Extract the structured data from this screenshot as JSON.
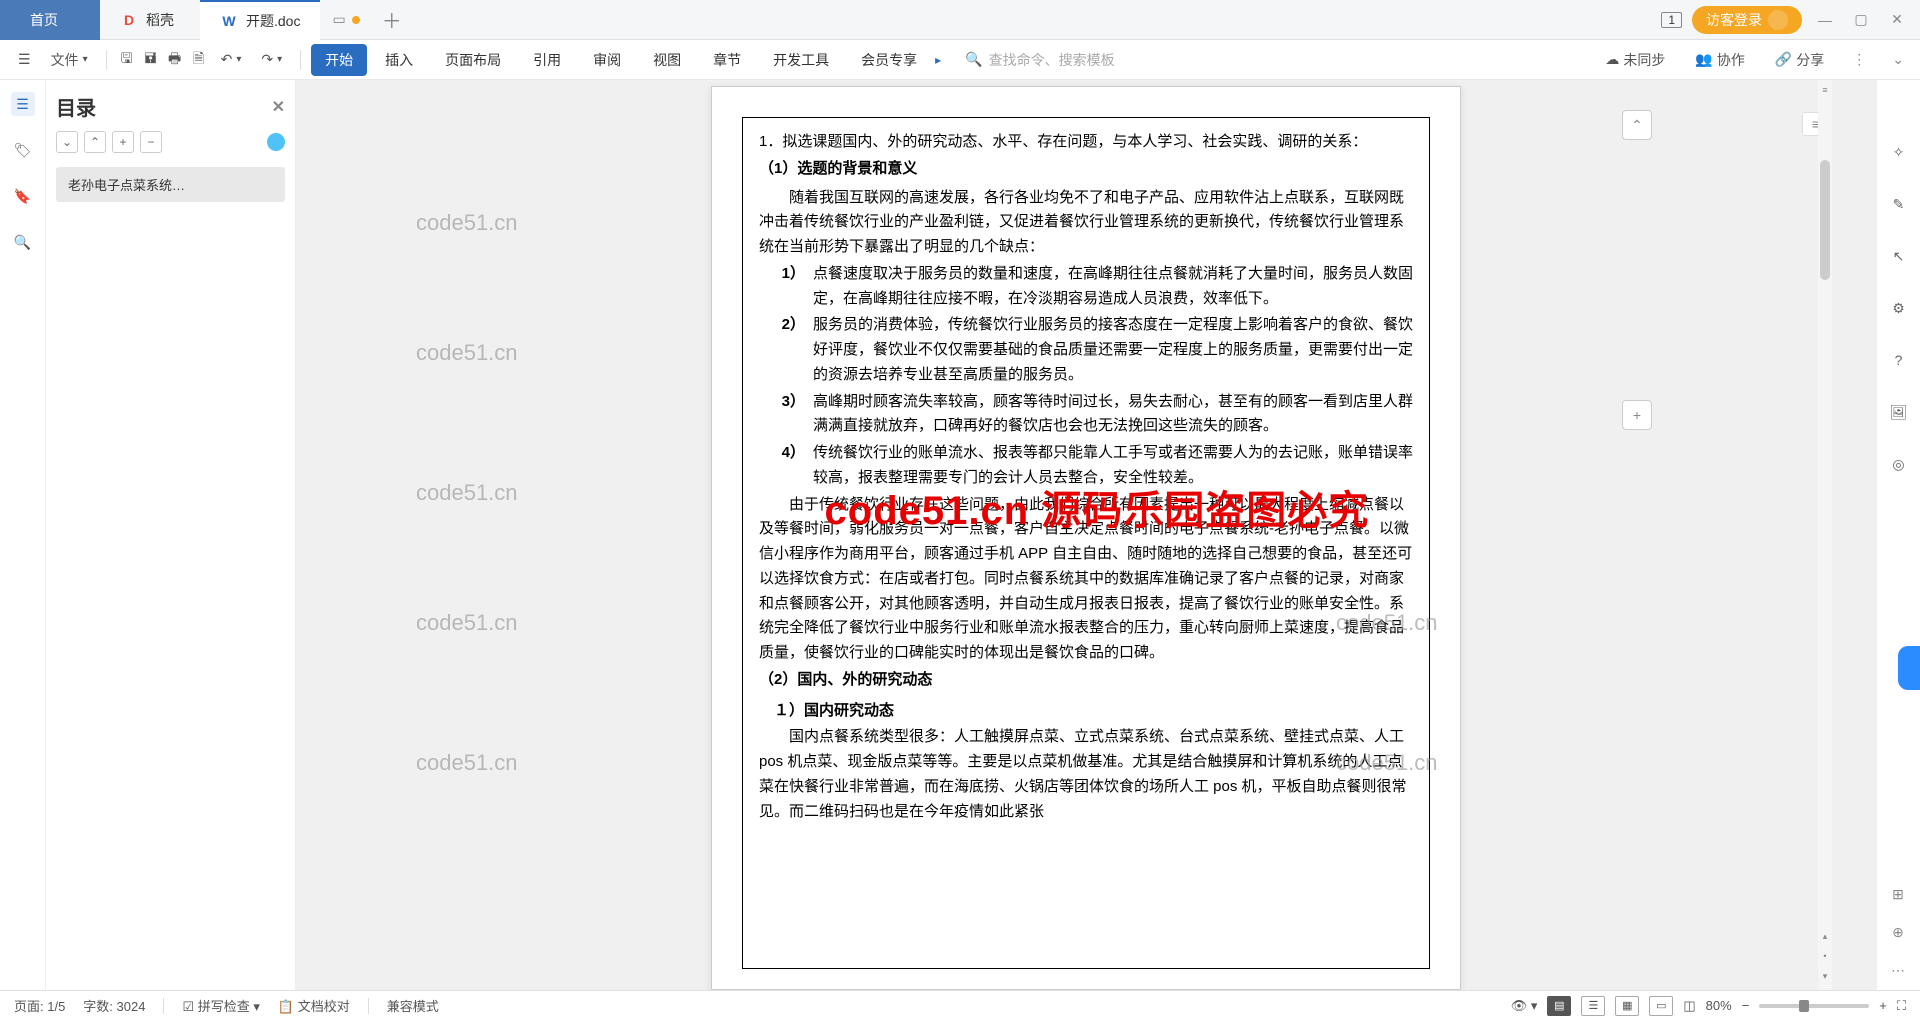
{
  "titleBar": {
    "homeTab": "首页",
    "dockerTab": "稻壳",
    "docTab": "开题.doc",
    "badge": "1",
    "loginLabel": "访客登录"
  },
  "toolbar": {
    "fileMenu": "文件",
    "ribbonTabs": [
      "开始",
      "插入",
      "页面布局",
      "引用",
      "审阅",
      "视图",
      "章节",
      "开发工具",
      "会员专享"
    ],
    "searchPlaceholder": "查找命令、搜索模板",
    "unsyncLabel": "未同步",
    "collabLabel": "协作",
    "shareLabel": "分享"
  },
  "outline": {
    "title": "目录",
    "item1": "老孙电子点菜系统…"
  },
  "doc": {
    "heading": "1．拟选课题国内、外的研究动态、水平、存在问题，与本人学习、社会实践、调研的关系：",
    "h1_1": "（1）选题的背景和意义",
    "p1": "随着我国互联网的高速发展，各行各业均免不了和电子产品、应用软件沾上点联系，互联网既冲击着传统餐饮行业的产业盈利链，又促进着餐饮行业管理系统的更新换代，传统餐饮行业管理系统在当前形势下暴露出了明显的几个缺点：",
    "l1n": "1）",
    "l1": "点餐速度取决于服务员的数量和速度，在高峰期往往点餐就消耗了大量时间，服务员人数固定，在高峰期往往应接不暇，在冷淡期容易造成人员浪费，效率低下。",
    "l2n": "2）",
    "l2": "服务员的消费体验，传统餐饮行业服务员的接客态度在一定程度上影响着客户的食欲、餐饮好评度，餐饮业不仅仅需要基础的食品质量还需要一定程度上的服务质量，更需要付出一定的资源去培养专业甚至高质量的服务员。",
    "l3n": "3）",
    "l3": "高峰期时顾客流失率较高，顾客等待时间过长，易失去耐心，甚至有的顾客一看到店里人群满满直接就放弃，口碑再好的餐饮店也会也无法挽回这些流失的顾客。",
    "l4n": "4）",
    "l4": "传统餐饮行业的账单流水、报表等都只能靠人工手写或者还需要人为的去记账，账单错误率较高，报表整理需要专门的会计人员去整合，安全性较差。",
    "p2": "由于传统餐饮行业存在这些问题，由此我们综合所有因素提出一种可以最大程度上缩减点餐以及等餐时间，弱化服务员一对一点餐，客户自主决定点餐时间的电子点餐系统-老孙电子点餐。以微信小程序作为商用平台，顾客通过手机 APP 自主自由、随时随地的选择自己想要的食品，甚至还可以选择饮食方式：在店或者打包。同时点餐系统其中的数据库准确记录了客户点餐的记录，对商家和点餐顾客公开，对其他顾客透明，并自动生成月报表日报表，提高了餐饮行业的账单安全性。系统完全降低了餐饮行业中服务行业和账单流水报表整合的压力，重心转向厨师上菜速度，提高食品质量，使餐饮行业的口碑能实时的体现出是餐饮食品的口碑。",
    "h1_2": "（2）国内、外的研究动态",
    "h2_1": "１）国内研究动态",
    "p3": "国内点餐系统类型很多：人工触摸屏点菜、立式点菜系统、台式点菜系统、壁挂式点菜、人工 pos 机点菜、现金版点菜等等。主要是以点菜机做基准。尤其是结合触摸屏和计算机系统的人工点菜在快餐行业非常普遍，而在海底捞、火锅店等团体饮食的场所人工 pos 机，平板自助点餐则很常见。而二维码扫码也是在今年疫情如此紧张"
  },
  "watermarks": {
    "wm": "code51.cn",
    "red": "code51.cn 源码乐园盗图必究"
  },
  "statusBar": {
    "page": "页面: 1/5",
    "words": "字数: 3024",
    "spell": "拼写检查",
    "proof": "文档校对",
    "compat": "兼容模式",
    "zoom": "80%"
  }
}
